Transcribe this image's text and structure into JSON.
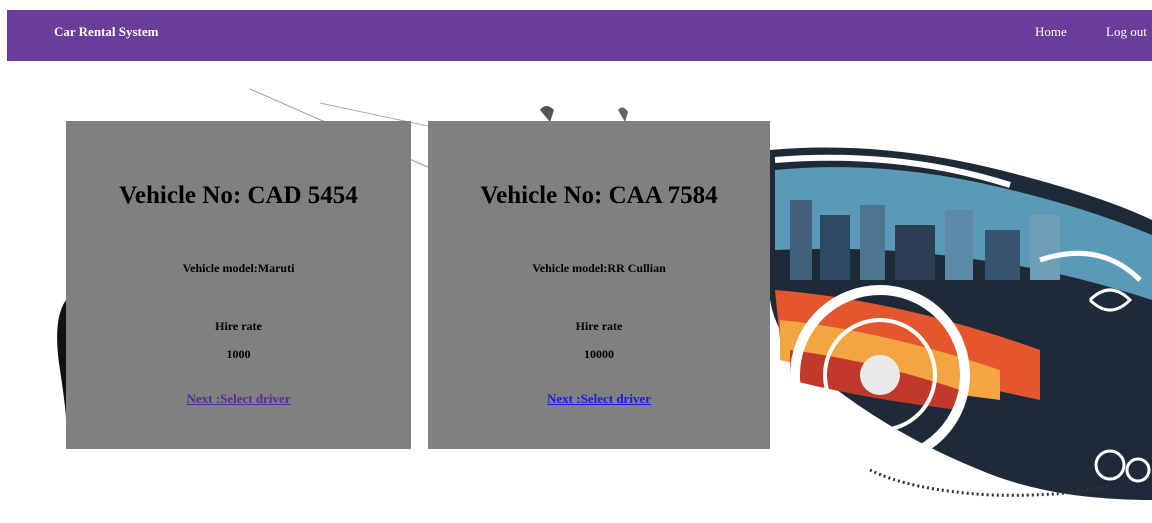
{
  "navbar": {
    "brand": "Car Rental System",
    "home_label": "Home",
    "logout_label": "Log out",
    "bg_color": "#6a3d9a"
  },
  "vehicles": [
    {
      "title": "Vehicle No: CAD 5454",
      "model": "Vehicle model:Maruti",
      "hire_rate_label": "Hire rate",
      "hire_rate": "1000",
      "link_label": "Next :Select driver"
    },
    {
      "title": "Vehicle No: CAA 7584",
      "model": "Vehicle model:RR Cullian",
      "hire_rate_label": "Hire rate",
      "hire_rate": "10000",
      "link_label": "Next :Select driver"
    }
  ],
  "colors": {
    "card_bg": "#808080",
    "visited_link": "#5b2d91",
    "link": "#1a1aee"
  }
}
